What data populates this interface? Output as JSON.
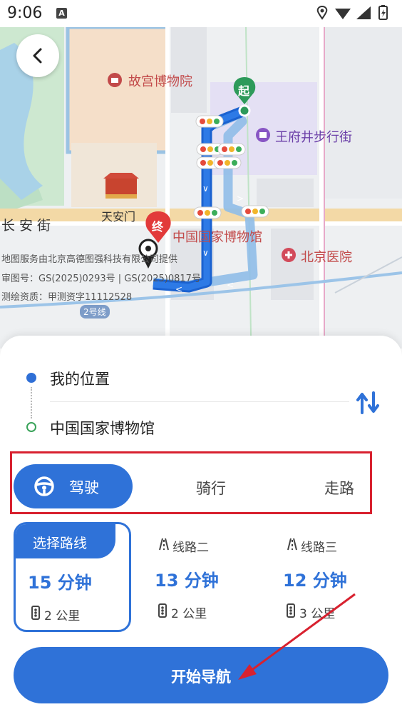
{
  "status_bar": {
    "time": "9:06",
    "notification_icon": "A"
  },
  "map": {
    "labels": {
      "palace_museum": "故宫博物院",
      "wangfujing": "王府井步行街",
      "tiananmen": "天安门",
      "changan_street": "长安街",
      "national_museum": "中国国家博物馆",
      "beijing_hospital": "北京医院",
      "start_marker": "起",
      "end_marker": "终",
      "subway_line": "2号线"
    },
    "credits": {
      "line1": "地图服务由北京高德图强科技有限公司提供",
      "line2": "审图号：GS(2025)0293号 | GS(2025)0817号",
      "line3": "测绘资质：甲测资字11112528"
    }
  },
  "route_input": {
    "origin": "我的位置",
    "destination": "中国国家博物馆"
  },
  "modes": {
    "drive": "驾驶",
    "bike": "骑行",
    "walk": "走路"
  },
  "routes": [
    {
      "label": "选择路线",
      "time": "15 分钟",
      "distance": "2 公里"
    },
    {
      "label": "线路二",
      "time": "13 分钟",
      "distance": "2 公里"
    },
    {
      "label": "线路三",
      "time": "12 分钟",
      "distance": "3 公里"
    }
  ],
  "start_navigation": "开始导航",
  "colors": {
    "accent": "#2f72d8",
    "annotation": "#d8212f"
  }
}
